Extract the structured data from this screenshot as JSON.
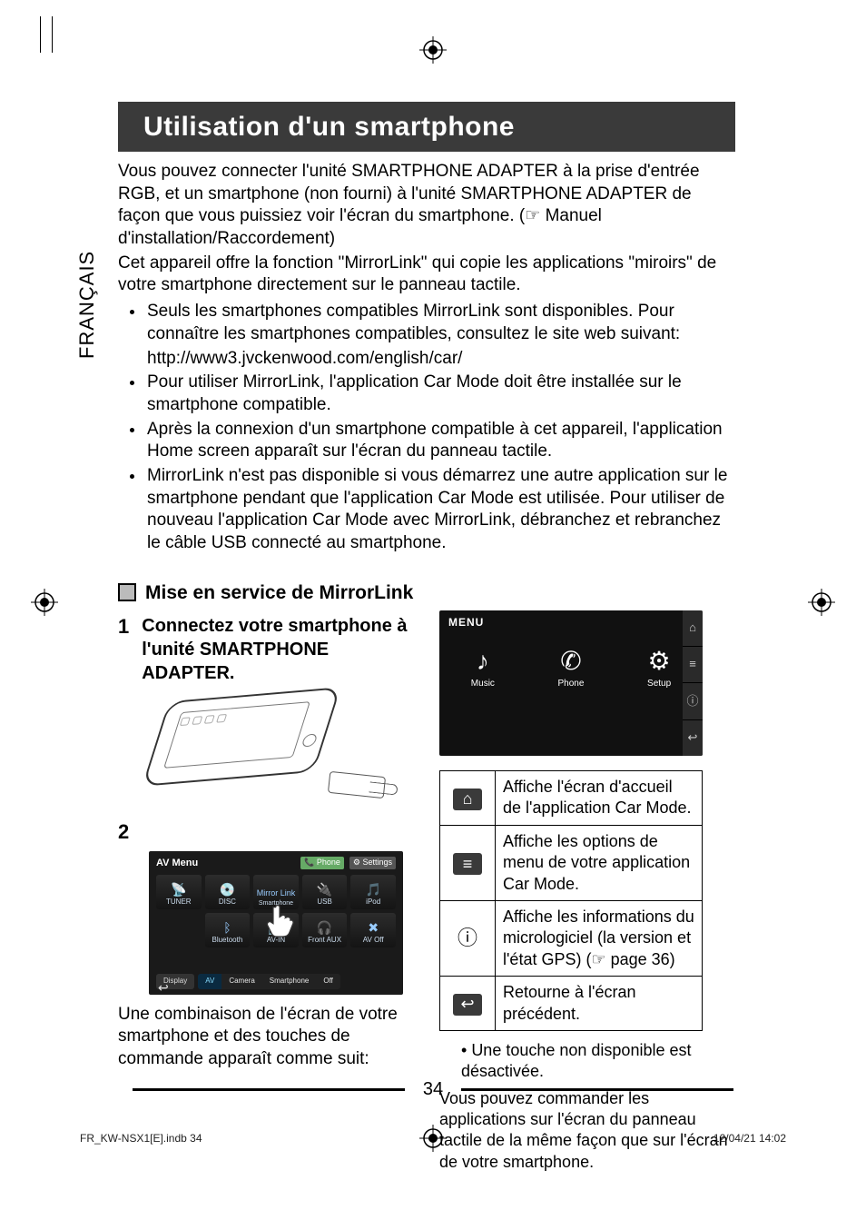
{
  "language_tab": "FRANÇAIS",
  "title": "Utilisation d'un smartphone",
  "intro_p1": "Vous pouvez connecter l'unité SMARTPHONE ADAPTER à la prise d'entrée RGB, et un smartphone (non fourni) à l'unité SMARTPHONE ADAPTER de façon que vous puissiez voir l'écran du smartphone. (☞ Manuel d'installation/Raccordement)",
  "intro_p2": "Cet appareil offre la fonction \"MirrorLink\" qui copie les applications \"miroirs\" de votre smartphone directement sur le panneau tactile.",
  "bullets": [
    {
      "text": "Seuls les smartphones compatibles MirrorLink sont disponibles. Pour connaître les smartphones compatibles, consultez le site web suivant:",
      "sub": "http://www3.jvckenwood.com/english/car/"
    },
    {
      "text": "Pour utiliser MirrorLink, l'application Car Mode doit être installée sur le smartphone compatible."
    },
    {
      "text": "Après la connexion d'un smartphone compatible à cet appareil, l'application Home screen apparaît sur l'écran du panneau tactile."
    },
    {
      "text": "MirrorLink n'est pas disponible si vous démarrez une autre application sur le smartphone pendant que l'application Car Mode est utilisée. Pour utiliser de nouveau l'application Car Mode avec MirrorLink, débranchez et rebranchez le câble USB connecté au smartphone."
    }
  ],
  "subheading": "Mise en service de MirrorLink",
  "steps": {
    "s1_num": "1",
    "s1_text": "Connectez votre smartphone à l'unité SMARTPHONE ADAPTER.",
    "s2_num": "2",
    "s2_caption": "Une combinaison de l'écran de votre smartphone et des touches de commande apparaît comme suit:"
  },
  "av_menu": {
    "title": "AV Menu",
    "phone": "Phone",
    "settings": "Settings",
    "tiles": [
      "TUNER",
      "DISC",
      "MirrorLink Smartphone",
      "USB",
      "iPod",
      "",
      "Bluetooth",
      "AV-IN",
      "Front AUX",
      "AV Off"
    ],
    "display": "Display",
    "seg": [
      "AV",
      "Camera",
      "Smartphone",
      "Off"
    ]
  },
  "menu_mock": {
    "header": "MENU",
    "items": [
      {
        "icon": "♪",
        "label": "Music"
      },
      {
        "icon": "✆",
        "label": "Phone"
      },
      {
        "icon": "⚙",
        "label": "Setup"
      }
    ],
    "side_icons": [
      "⌂",
      "≡",
      "ⓘ",
      "↩"
    ]
  },
  "icon_table": [
    {
      "icon": "⌂",
      "chip": true,
      "desc": "Affiche l'écran d'accueil de l'application Car Mode."
    },
    {
      "icon": "≡",
      "chip": true,
      "desc": "Affiche les options de menu de votre application Car Mode."
    },
    {
      "icon": "ⓘ",
      "chip": false,
      "desc": "Affiche les informations du micrologiciel (la version et l'état GPS) (☞ page 36)"
    },
    {
      "icon": "↩",
      "chip": true,
      "desc": "Retourne à l'écran précédent."
    }
  ],
  "note": "Une touche non disponible est désactivée.",
  "closing": "Vous pouvez commander les applications sur l'écran du panneau tactile de la même façon que sur l'écran de votre smartphone.",
  "page_number": "34",
  "slug_left": "FR_KW-NSX1[E].indb   34",
  "slug_right": "12/04/21   14:02"
}
